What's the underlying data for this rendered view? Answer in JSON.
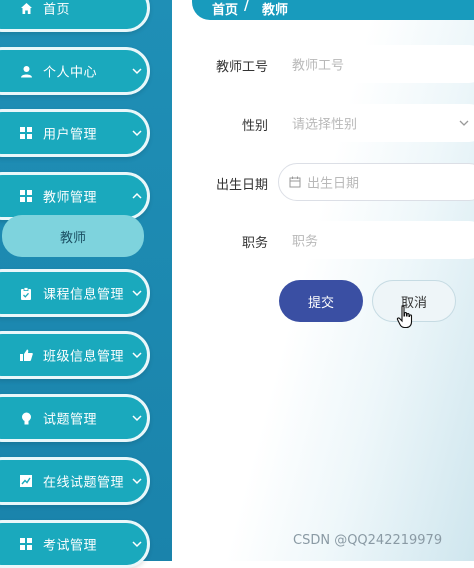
{
  "sidebar": {
    "items": [
      {
        "label": "首页",
        "icon": "home-icon"
      },
      {
        "label": "个人中心",
        "icon": "person-icon"
      },
      {
        "label": "用户管理",
        "icon": "grid-icon"
      },
      {
        "label": "教师管理",
        "icon": "grid-icon"
      },
      {
        "label": "课程信息管理",
        "icon": "clipboard-icon"
      },
      {
        "label": "班级信息管理",
        "icon": "thumb-icon"
      },
      {
        "label": "试题管理",
        "icon": "bulb-icon"
      },
      {
        "label": "在线试题管理",
        "icon": "chart-icon"
      },
      {
        "label": "考试管理",
        "icon": "grid-icon"
      }
    ],
    "sub_item": "教师"
  },
  "breadcrumb": {
    "home": "首页",
    "separator": "/",
    "current": "教师"
  },
  "form": {
    "teacher_id": {
      "label": "教师工号",
      "placeholder": "教师工号"
    },
    "gender": {
      "label": "性别",
      "placeholder": "请选择性别"
    },
    "birth_date": {
      "label": "出生日期",
      "placeholder": "出生日期"
    },
    "position": {
      "label": "职务",
      "placeholder": "职务"
    }
  },
  "buttons": {
    "submit": "提交",
    "cancel": "取消"
  },
  "watermark": "CSDN @QQ242219979",
  "colors": {
    "sidebar_bg": "#1f8fb6",
    "nav_pill": "#1aa9bd",
    "sub_item": "#7ed3dd",
    "submit_btn": "#3a4fa3",
    "breadcrumb_bg": "#189bbd"
  }
}
